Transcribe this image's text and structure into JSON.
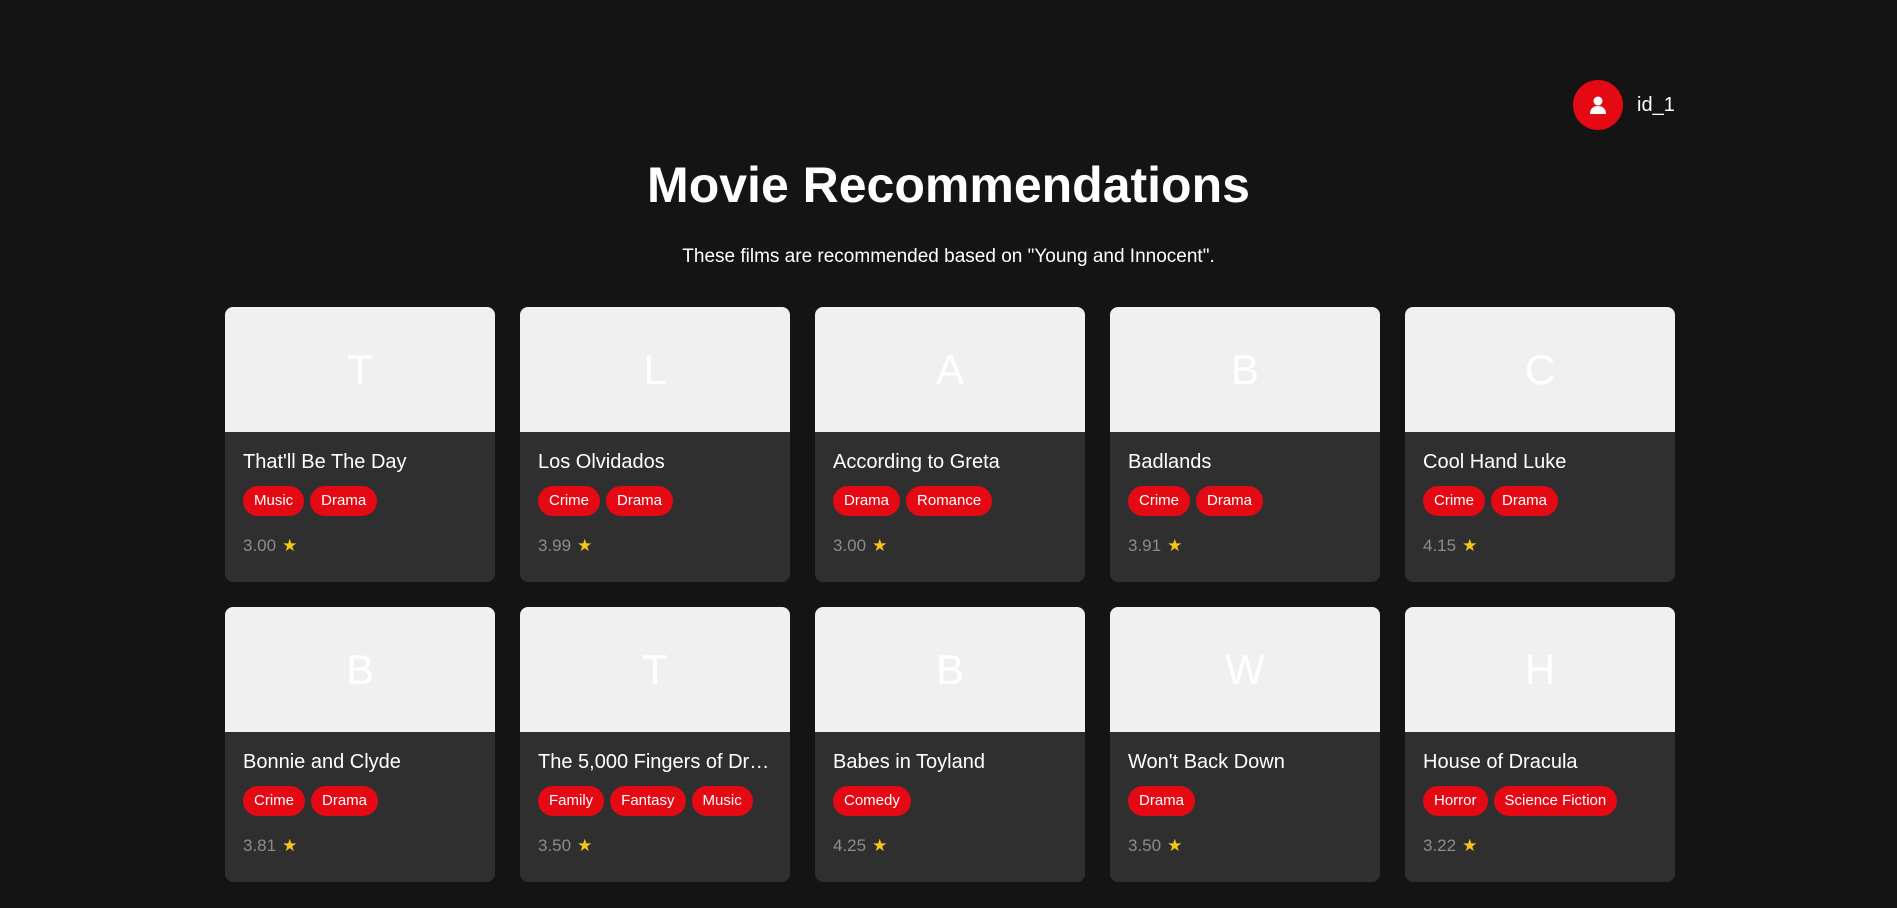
{
  "user": {
    "icon": "user-icon",
    "name": "id_1"
  },
  "header": {
    "title": "Movie Recommendations",
    "subtitle": "These films are recommended based on \"Young and Innocent\"."
  },
  "colors": {
    "accent": "#e50914",
    "background": "#141414",
    "card": "#2f2f2f",
    "poster": "#f0f0f0",
    "star": "#f5c518"
  },
  "movies": [
    {
      "initial": "T",
      "title": "That'll Be The Day",
      "genres": [
        "Music",
        "Drama"
      ],
      "rating": "3.00"
    },
    {
      "initial": "L",
      "title": "Los Olvidados",
      "genres": [
        "Crime",
        "Drama"
      ],
      "rating": "3.99"
    },
    {
      "initial": "A",
      "title": "According to Greta",
      "genres": [
        "Drama",
        "Romance"
      ],
      "rating": "3.00"
    },
    {
      "initial": "B",
      "title": "Badlands",
      "genres": [
        "Crime",
        "Drama"
      ],
      "rating": "3.91"
    },
    {
      "initial": "C",
      "title": "Cool Hand Luke",
      "genres": [
        "Crime",
        "Drama"
      ],
      "rating": "4.15"
    },
    {
      "initial": "B",
      "title": "Bonnie and Clyde",
      "genres": [
        "Crime",
        "Drama"
      ],
      "rating": "3.81"
    },
    {
      "initial": "T",
      "title": "The 5,000 Fingers of Dr…",
      "genres": [
        "Family",
        "Fantasy",
        "Music"
      ],
      "rating": "3.50"
    },
    {
      "initial": "B",
      "title": "Babes in Toyland",
      "genres": [
        "Comedy"
      ],
      "rating": "4.25"
    },
    {
      "initial": "W",
      "title": "Won't Back Down",
      "genres": [
        "Drama"
      ],
      "rating": "3.50"
    },
    {
      "initial": "H",
      "title": "House of Dracula",
      "genres": [
        "Horror",
        "Science Fiction"
      ],
      "rating": "3.22"
    }
  ],
  "star_icon": "star-icon",
  "star_glyph": "★"
}
